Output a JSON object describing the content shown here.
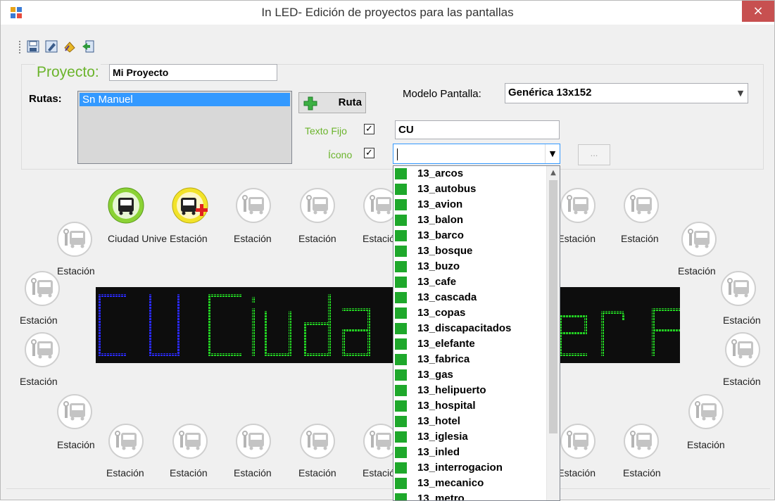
{
  "window": {
    "title": "In LED- Edición de proyectos para las pantallas",
    "close_label": "×"
  },
  "toolbar": {
    "buttons": [
      "save-icon",
      "edit-icon",
      "wizard-icon",
      "exit-icon"
    ]
  },
  "project": {
    "label": "Proyecto:",
    "name": "Mi Proyecto"
  },
  "rutas": {
    "label": "Rutas:",
    "items": [
      "Sn Manuel"
    ],
    "add_button": "Ruta"
  },
  "modelo": {
    "label": "Modelo Pantalla:",
    "value": "Genérica 13x152"
  },
  "texto_fijo": {
    "label": "Texto Fijo",
    "checked": true,
    "value": "CU"
  },
  "icono": {
    "label": "Ícono",
    "checked": true,
    "value": "",
    "dots_button": "..."
  },
  "stations": {
    "first_label": "Ciudad Unive",
    "second_label": "Estación",
    "default_label": "Estación"
  },
  "led_display": {
    "blue_text": "CU",
    "green_text": "Ciudad Univer",
    "colors": {
      "blue": "#2a2aff",
      "green": "#22d022"
    }
  },
  "icon_list": [
    "13_arcos",
    "13_autobus",
    "13_avion",
    "13_balon",
    "13_barco",
    "13_bosque",
    "13_buzo",
    "13_cafe",
    "13_cascada",
    "13_copas",
    "13_discapacitados",
    "13_elefante",
    "13_fabrica",
    "13_gas",
    "13_helipuerto",
    "13_hospital",
    "13_hotel",
    "13_iglesia",
    "13_inled",
    "13_interrogacion",
    "13_mecanico",
    "13_metro"
  ],
  "colors": {
    "accent_green": "#6bb42c",
    "selection_blue": "#3399ff",
    "close_red": "#c75050"
  }
}
